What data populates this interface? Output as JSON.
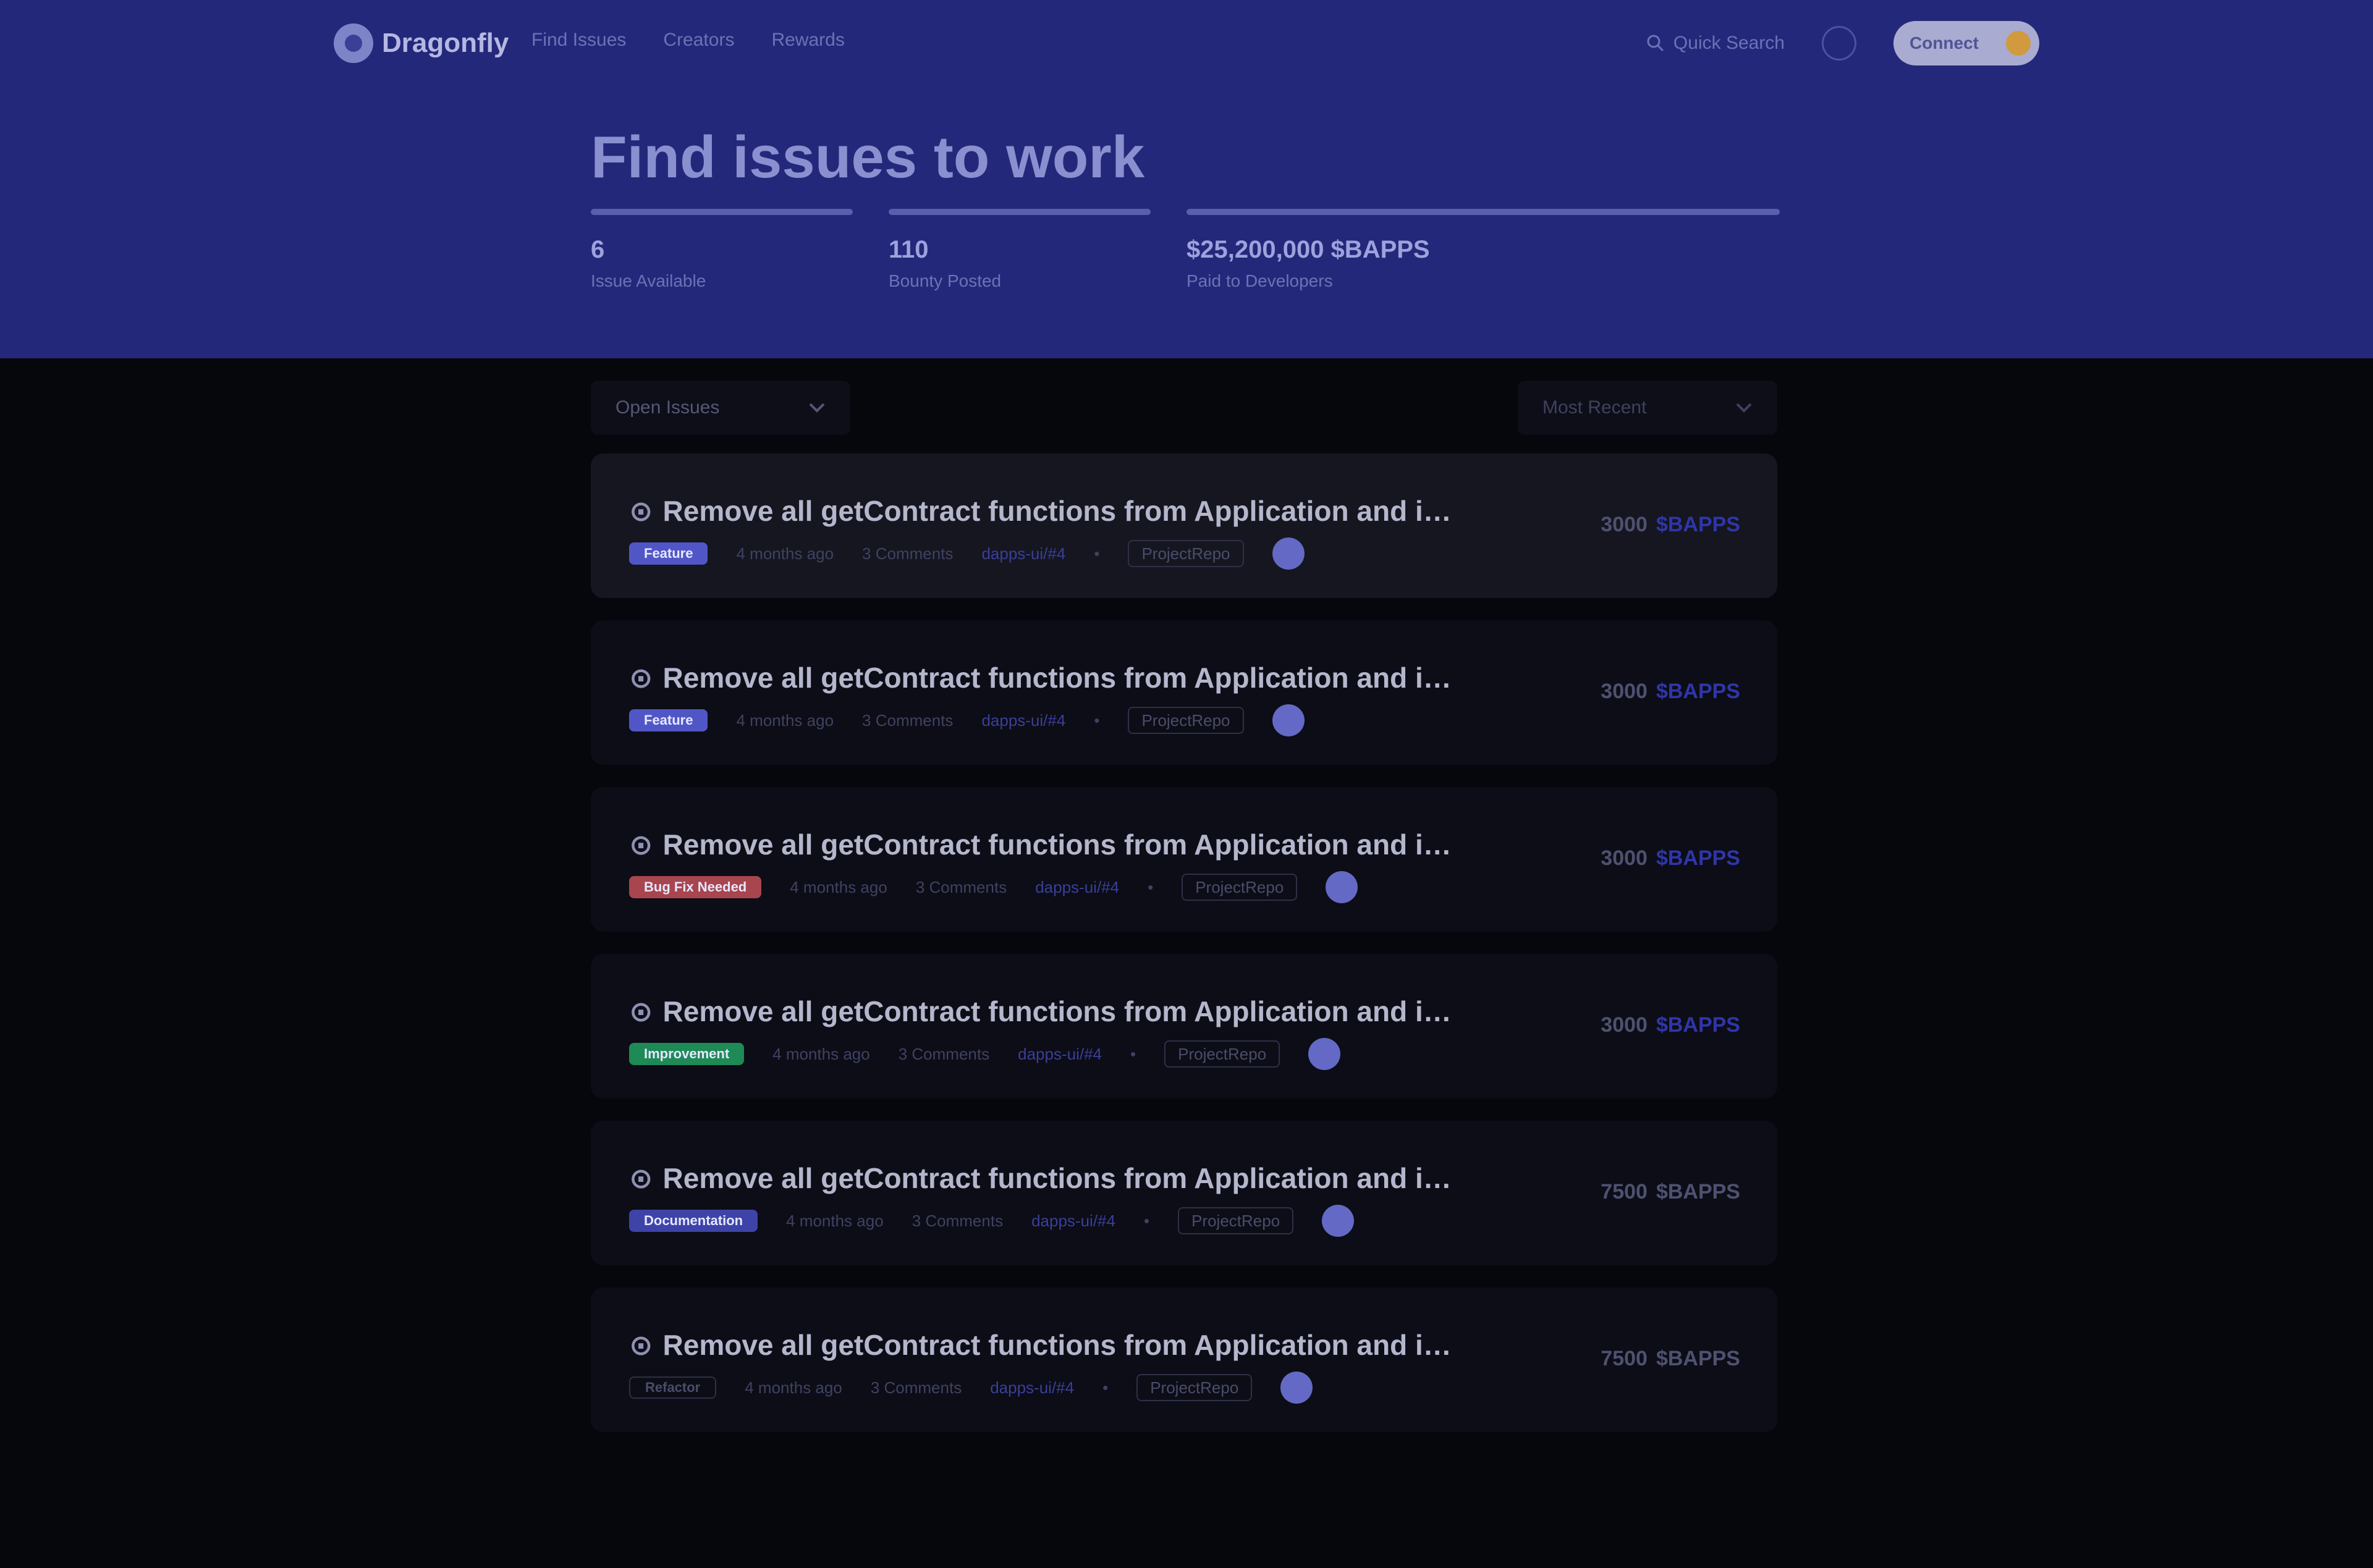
{
  "header": {
    "logo_text": "Dragonfly",
    "nav": [
      "Find Issues",
      "Creators",
      "Rewards"
    ],
    "quick_search_label": "Quick Search",
    "connect_label": "Connect"
  },
  "page_title": "Find issues to work",
  "stats": [
    {
      "value": "6",
      "label": "Issue Available"
    },
    {
      "value": "110",
      "label": "Bounty Posted"
    },
    {
      "value": "$25,200,000 $BAPPS",
      "label": "Paid to Developers"
    }
  ],
  "filters": {
    "filter_label": "Open Issues",
    "sort_label": "Most Recent"
  },
  "issues": [
    {
      "title": "Remove all getContract functions from Application and instead...",
      "tag": "Feature",
      "tag_color": "#5156c7",
      "posted": "4 months ago",
      "comments": "3 Comments",
      "link": "dapps-ui/#4",
      "repo": "ProjectRepo",
      "reward_amount": "3000",
      "reward_currency": "$BAPPS"
    },
    {
      "title": "Remove all getContract functions from Application and instead...",
      "tag": "Feature",
      "tag_color": "#5156c7",
      "posted": "4 months ago",
      "comments": "3 Comments",
      "link": "dapps-ui/#4",
      "repo": "ProjectRepo",
      "reward_amount": "3000",
      "reward_currency": "$BAPPS"
    },
    {
      "title": "Remove all getContract functions from Application and instead...",
      "tag": "Bug Fix Needed",
      "tag_color": "#a8454e",
      "posted": "4 months ago",
      "comments": "3 Comments",
      "link": "dapps-ui/#4",
      "repo": "ProjectRepo",
      "reward_amount": "3000",
      "reward_currency": "$BAPPS"
    },
    {
      "title": "Remove all getContract functions from Application and instead...",
      "tag": "Improvement",
      "tag_color": "#1e8a56",
      "posted": "4 months ago",
      "comments": "3 Comments",
      "link": "dapps-ui/#4",
      "repo": "ProjectRepo",
      "reward_amount": "3000",
      "reward_currency": "$BAPPS"
    },
    {
      "title": "Remove all getContract functions from Application and instead...",
      "tag": "Documentation",
      "tag_color": "#3e43a8",
      "posted": "4 months ago",
      "comments": "3 Comments",
      "link": "dapps-ui/#4",
      "repo": "ProjectRepo",
      "reward_amount": "7500",
      "reward_currency": "$BAPPS"
    },
    {
      "title": "Remove all getContract functions from Application and instead...",
      "tag": "Refactor",
      "tag_color": "#0c0d16",
      "posted": "4 months ago",
      "comments": "3 Comments",
      "link": "dapps-ui/#4",
      "repo": "ProjectRepo",
      "reward_amount": "7500",
      "reward_currency": "$BAPPS"
    }
  ]
}
